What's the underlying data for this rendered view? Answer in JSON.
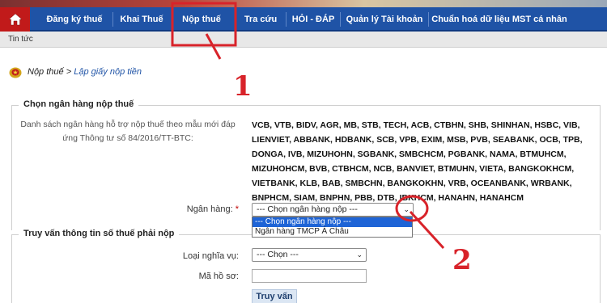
{
  "nav": {
    "items": [
      "Đăng ký thuế",
      "Khai Thuế",
      "Nộp thuế",
      "Tra cứu",
      "HỎI - ĐÁP",
      "Quản lý Tài khoản",
      "Chuẩn hoá dữ liệu MST cá nhân"
    ]
  },
  "subnav": {
    "news": "Tin tức"
  },
  "breadcrumb": {
    "section": "Nộp thuế",
    "sep": " > ",
    "page": "Lập giấy nộp tiền"
  },
  "bank_section": {
    "title": "Chọn ngân hàng nộp thuế",
    "desc_lines": [
      "Danh sách ngân hàng hỗ trợ nộp thuế theo mẫu mới đáp",
      "ứng Thông tư số 84/2016/TT-BTC:"
    ],
    "bank_lines": [
      "VCB, VTB, BIDV, AGR, MB, STB, TECH, ACB, CTBHN, SHB, SHINHAN, HSBC, VIB,",
      "LIENVIET, ABBANK, HDBANK, SCB, VPB, EXIM, MSB, PVB, SEABANK, OCB, TPB,",
      "DONGA, IVB, MIZUHOHN, SGBANK, SMBCHCM, PGBANK, NAMA, BTMUHCM,",
      "MIZUHOHCM, BVB, CTBHCM, NCB, BANVIET, BTMUHN, VIETA, BANGKOKHCM,",
      "VIETBANK, KLB, BAB, SMBCHN, BANGKOKHN, VRB, OCEANBANK, WRBANK,",
      "BNPHCM, SIAM, BNPHN, PBB, DTB, IBKHCM, HANAHN, HANAHCM"
    ],
    "bank_label": "Ngân hàng:",
    "required_mark": "*",
    "bank_select_value": "--- Chọn ngân hàng nộp ---",
    "bank_options": [
      "--- Chọn ngân hàng nộp ---",
      "Ngân hàng TMCP Á Châu"
    ]
  },
  "query_section": {
    "title": "Truy vấn thông tin số thuế phải nộp",
    "obligation_label": "Loại nghĩa vụ:",
    "obligation_value": "--- Chọn ---",
    "file_label": "Mã hồ sơ:",
    "file_value": "",
    "query_button": "Truy vấn"
  },
  "annotations": {
    "step1": "1",
    "step2": "2",
    "color": "#d8232a"
  },
  "colors": {
    "navbar": "#1f53a6",
    "home": "#c11a1a",
    "link": "#1f53a6",
    "highlight": "#1e64d6"
  }
}
